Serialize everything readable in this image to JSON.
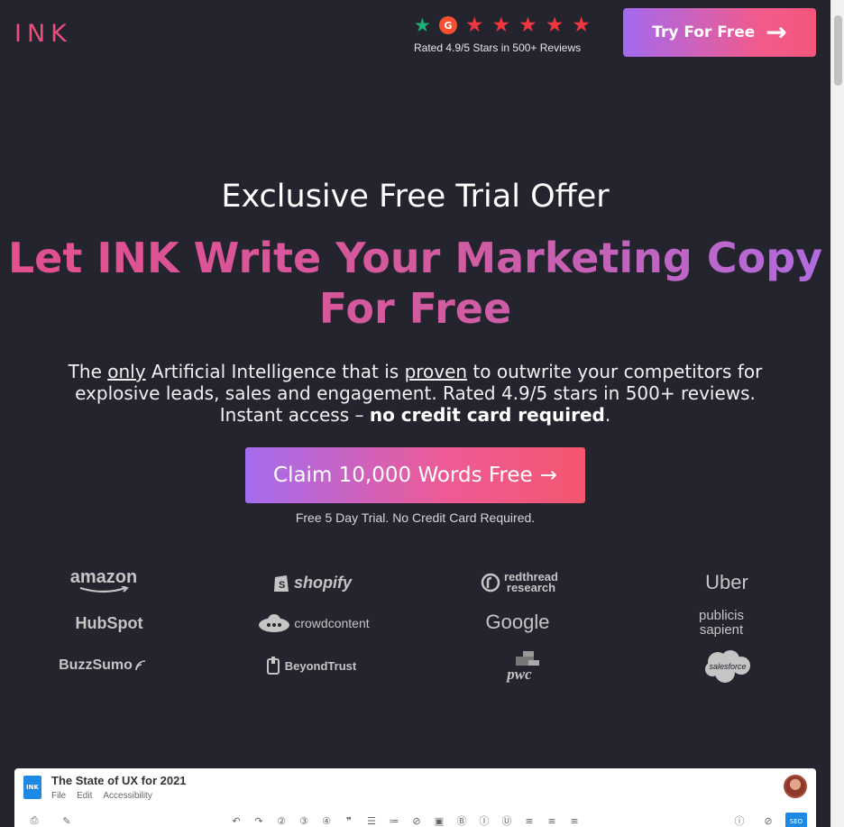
{
  "header": {
    "logo_text": "INK",
    "rating_text": "Rated 4.9/5 Stars in 500+ Reviews",
    "g2_label": "G",
    "try_button": "Try For Free",
    "try_arrow": "→"
  },
  "hero": {
    "kicker": "Exclusive Free Trial Offer",
    "title_line1": "Let INK Write Your Marketing Copy",
    "title_line2": "For Free",
    "desc_part1": "The ",
    "desc_only": "only",
    "desc_part2": " Artificial Intelligence that is ",
    "desc_proven": "proven",
    "desc_part3": " to outwrite your competitors for explosive leads, sales and engagement. Rated 4.9/5 stars in 500+ reviews. Instant access – ",
    "desc_bold": "no credit card required",
    "desc_end": ".",
    "cta_label": "Claim 10,000 Words Free",
    "cta_arrow": "→",
    "note": "Free 5 Day Trial. No Credit Card Required."
  },
  "logos": {
    "amazon": "amazon",
    "shopify": "shopify",
    "redthread_1": "redthread",
    "redthread_2": "research",
    "uber": "Uber",
    "hubspot": "HubSpot",
    "crowdcontent": "crowdcontent",
    "google": "Google",
    "publicis_1": "publicis",
    "publicis_2": "sapient",
    "buzzsumo": "BuzzSumo",
    "beyondtrust": "BeyondTrust",
    "pwc": "pwc",
    "salesforce": "salesforce"
  },
  "app_preview": {
    "doc_icon": "INK",
    "doc_title": "The State of UX for 2021",
    "menu": [
      "File",
      "Edit",
      "Accessibility"
    ],
    "seo_label": "SEO"
  },
  "colors": {
    "background": "#24242f",
    "accent_pink": "#e94f7a",
    "accent_purple": "#a469f0",
    "star_red": "#f0363f",
    "star_green": "#1bb478"
  },
  "rating_stars": 5
}
